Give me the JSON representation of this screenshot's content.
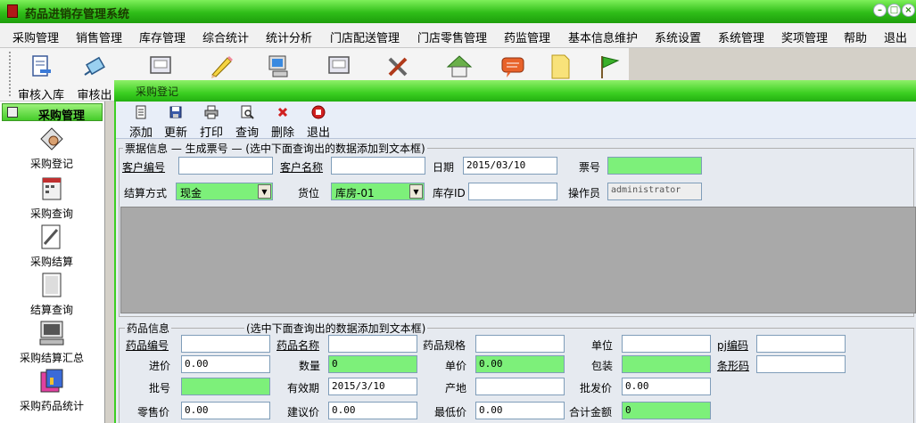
{
  "window": {
    "title": "药品进销存管理系统"
  },
  "menu": [
    "采购管理",
    "销售管理",
    "库存管理",
    "综合统计",
    "统计分析",
    "门店配送管理",
    "门店零售管理",
    "药监管理",
    "基本信息维护",
    "系统设置",
    "系统管理",
    "奖项管理",
    "帮助",
    "退出"
  ],
  "toolbar": {
    "btn1": "审核入库",
    "btn2": "审核出"
  },
  "subwindow": {
    "title": "采购登记"
  },
  "sidebar": {
    "header": "采购管理",
    "items": [
      "采购登记",
      "采购查询",
      "采购结算",
      "结算查询",
      "采购结算汇总",
      "采购药品统计"
    ]
  },
  "form_toolbar": [
    "添加",
    "更新",
    "打印",
    "查询",
    "删除",
    "退出"
  ],
  "ticket": {
    "group_title": "票据信息 — 生成票号 — (选中下面查询出的数据添加到文本框)",
    "customer_code_label": "客户编号",
    "customer_code": "",
    "customer_name_label": "客户名称",
    "customer_name": "",
    "date_label": "日期",
    "date": "2015/03/10",
    "ticket_no_label": "票号",
    "ticket_no": "",
    "settle_label": "结算方式",
    "settle": "现金",
    "location_label": "货位",
    "location": "库房-01",
    "stock_id_label": "库存ID",
    "stock_id": "",
    "operator_label": "操作员",
    "operator": "administrator"
  },
  "drug": {
    "group_title_a": "药品信息",
    "group_title_b": "(选中下面查询出的数据添加到文本框)",
    "code_label": "药品编号",
    "code": "",
    "name_label": "药品名称",
    "name": "",
    "spec_label": "药品规格",
    "spec": "",
    "unit_label": "单位",
    "unit": "",
    "pj_label": "pj编码",
    "pj": "",
    "inprice_label": "进价",
    "inprice": "0.00",
    "qty_label": "数量",
    "qty": "0",
    "price_label": "单价",
    "price": "0.00",
    "pack_label": "包装",
    "pack": "",
    "barcode_label": "条形码",
    "barcode": "",
    "batch_label": "批号",
    "batch": "",
    "expiry_label": "有效期",
    "expiry": "2015/3/10",
    "origin_label": "产地",
    "origin": "",
    "wholesale_label": "批发价",
    "wholesale": "0.00",
    "retail_label": "零售价",
    "retail": "0.00",
    "suggest_label": "建议价",
    "suggest": "0.00",
    "min_label": "最低价",
    "min": "0.00",
    "total_label": "合计金额",
    "total": "0"
  }
}
